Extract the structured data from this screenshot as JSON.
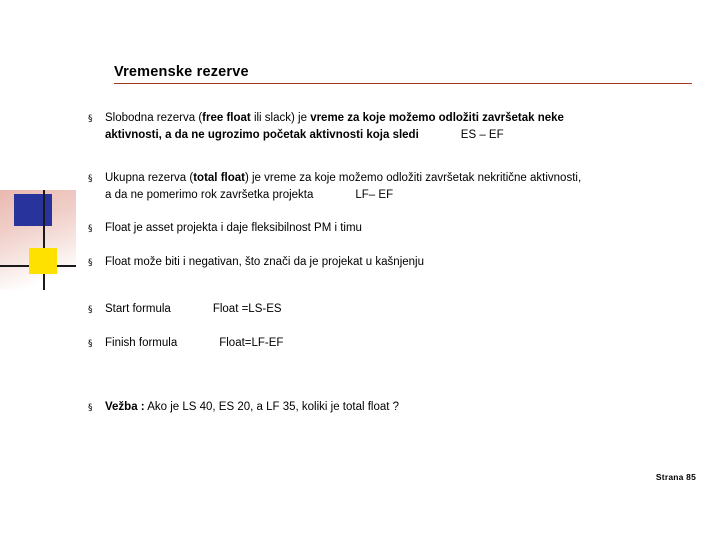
{
  "slide": {
    "title": "Vremenske rezerve",
    "accent_color": "#a33a1f",
    "bullet_glyph": "§",
    "footer": "Strana 85"
  },
  "bullets": [
    {
      "id": "slobodna-rezerva",
      "line1_a": "Slobodna rezerva (",
      "line1_b": "free float",
      "line1_c": " ili slack) je ",
      "line1_d": "vreme za koje možemo odložiti završetak neke",
      "line2_a": "aktivnosti, a da ne ugrozimo početak aktivnosti koja sledi",
      "line2_b": "ES – EF"
    },
    {
      "id": "ukupna-rezerva",
      "line1_a": "Ukupna rezerva  (",
      "line1_b": "total float",
      "line1_c": ") je vreme za koje možemo odložiti završetak nekritične aktivnosti,",
      "line2_a": "a da ne pomerimo rok završetka projekta",
      "line2_b": "LF– EF"
    },
    {
      "id": "float-asset",
      "text": "Float je asset projekta i daje fleksibilnost PM i timu"
    },
    {
      "id": "float-negativan",
      "text": "Float može biti i negativan, što znači da je projekat u kašnjenju"
    },
    {
      "id": "start-formula",
      "label": "Start formula",
      "value": "Float =LS-ES"
    },
    {
      "id": "finish-formula",
      "label": "Finish formula",
      "value": "Float=LF-EF"
    },
    {
      "id": "vezba",
      "label": "Vežba :",
      "text": " Ako je LS 40, ES 20, a LF 35, koliki je total float ?"
    }
  ]
}
